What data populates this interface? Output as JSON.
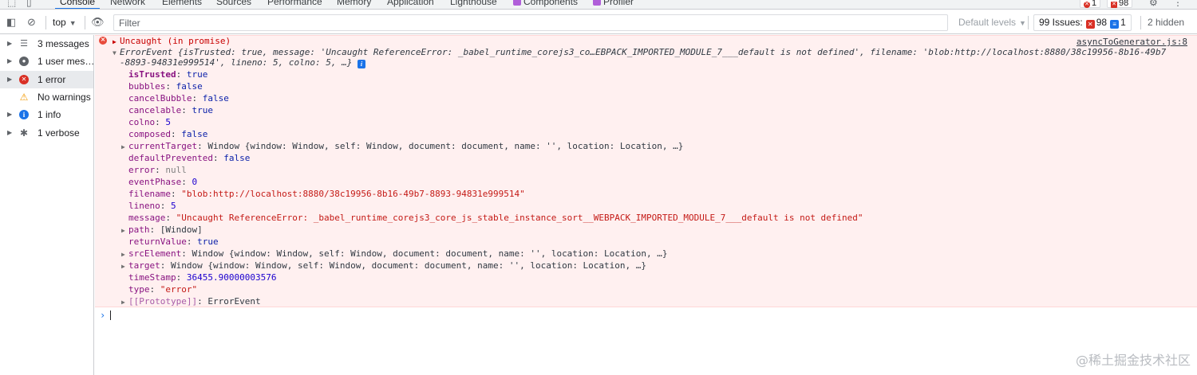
{
  "tabs": {
    "items": [
      {
        "label": "Console",
        "active": true
      },
      {
        "label": "Network"
      },
      {
        "label": "Elements"
      },
      {
        "label": "Sources"
      },
      {
        "label": "Performance"
      },
      {
        "label": "Memory"
      },
      {
        "label": "Application"
      },
      {
        "label": "Lighthouse"
      },
      {
        "label": "Components"
      },
      {
        "label": "Profiler"
      }
    ],
    "error_count": "1",
    "issue_count": "98"
  },
  "toolbar": {
    "context": "top",
    "filter_placeholder": "Filter",
    "levels": "Default levels",
    "issues_label": "99 Issues:",
    "issues_red": "98",
    "issues_blue": "1",
    "hidden": "2 hidden"
  },
  "sidebar": {
    "items": [
      {
        "label": "3 messages",
        "icon": "list-icon"
      },
      {
        "label": "1 user mes…",
        "icon": "user-icon"
      },
      {
        "label": "1 error",
        "icon": "error-icon",
        "selected": true
      },
      {
        "label": "No warnings",
        "icon": "warning-icon"
      },
      {
        "label": "1 info",
        "icon": "info-icon"
      },
      {
        "label": "1 verbose",
        "icon": "bug-icon"
      }
    ]
  },
  "console": {
    "header": "Uncaught (in promise)",
    "source": "asyncToGenerator.js:8",
    "summary_line1": "ErrorEvent {isTrusted: true, message: 'Uncaught ReferenceError: _babel_runtime_corejs3_co…EBPACK_IMPORTED_MODULE_7___default is not defined', filename: 'blob:http://localhost:8880/38c19956-8b16-49b7",
    "summary_line2": "-8893-94831e999514', lineno: 5, colno: 5, …}",
    "props": [
      {
        "key": "isTrusted",
        "value": "true",
        "type": "bool",
        "bold": true
      },
      {
        "key": "bubbles",
        "value": "false",
        "type": "bool"
      },
      {
        "key": "cancelBubble",
        "value": "false",
        "type": "bool"
      },
      {
        "key": "cancelable",
        "value": "true",
        "type": "bool"
      },
      {
        "key": "colno",
        "value": "5",
        "type": "num"
      },
      {
        "key": "composed",
        "value": "false",
        "type": "bool"
      },
      {
        "key": "currentTarget",
        "value": "Window {window: Window, self: Window, document: document, name: '', location: Location, …}",
        "type": "plain",
        "expandable": true
      },
      {
        "key": "defaultPrevented",
        "value": "false",
        "type": "bool"
      },
      {
        "key": "error",
        "value": "null",
        "type": "nul"
      },
      {
        "key": "eventPhase",
        "value": "0",
        "type": "num"
      },
      {
        "key": "filename",
        "value": "\"blob:http://localhost:8880/38c19956-8b16-49b7-8893-94831e999514\"",
        "type": "str"
      },
      {
        "key": "lineno",
        "value": "5",
        "type": "num"
      },
      {
        "key": "message",
        "value": "\"Uncaught ReferenceError: _babel_runtime_corejs3_core_js_stable_instance_sort__WEBPACK_IMPORTED_MODULE_7___default is not defined\"",
        "type": "str"
      },
      {
        "key": "path",
        "value": "[Window]",
        "type": "plain",
        "expandable": true
      },
      {
        "key": "returnValue",
        "value": "true",
        "type": "bool"
      },
      {
        "key": "srcElement",
        "value": "Window {window: Window, self: Window, document: document, name: '', location: Location, …}",
        "type": "plain",
        "expandable": true
      },
      {
        "key": "target",
        "value": "Window {window: Window, self: Window, document: document, name: '', location: Location, …}",
        "type": "plain",
        "expandable": true
      },
      {
        "key": "timeStamp",
        "value": "36455.90000003576",
        "type": "num"
      },
      {
        "key": "type",
        "value": "\"error\"",
        "type": "str"
      },
      {
        "key": "[[Prototype]]",
        "value": "ErrorEvent",
        "type": "plain",
        "expandable": true,
        "dim": true
      }
    ]
  },
  "watermark": "@稀土掘金技术社区"
}
